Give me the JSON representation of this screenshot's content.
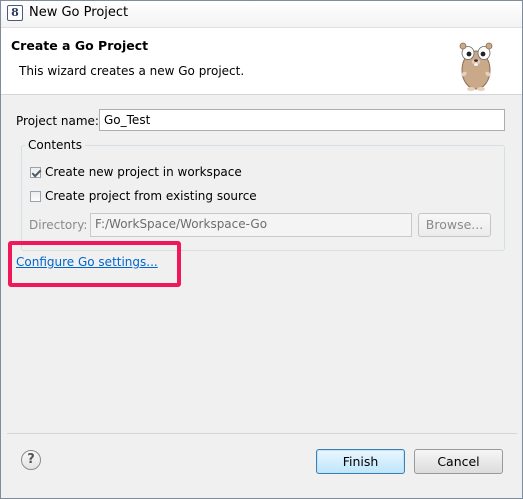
{
  "window": {
    "title": "New Go Project",
    "app_icon": "eclipse-icon"
  },
  "banner": {
    "title": "Create a Go Project",
    "description": "This wizard creates a new Go project.",
    "image": "go-gopher-icon"
  },
  "form": {
    "project_name_label": "Project name:",
    "project_name_value": "Go_Test",
    "contents_label": "Contents",
    "option_new": {
      "label": "Create new project in workspace",
      "checked": true
    },
    "option_existing": {
      "label": "Create project from existing source",
      "checked": false
    },
    "directory_label": "Directory:",
    "directory_value": "F:/WorkSpace/Workspace-Go",
    "browse_label": "Browse..."
  },
  "configure_link": "Configure Go settings...",
  "highlight_color": "#f0185a",
  "footer": {
    "help_icon": "help-icon",
    "help_glyph": "?",
    "finish_label": "Finish",
    "cancel_label": "Cancel"
  }
}
